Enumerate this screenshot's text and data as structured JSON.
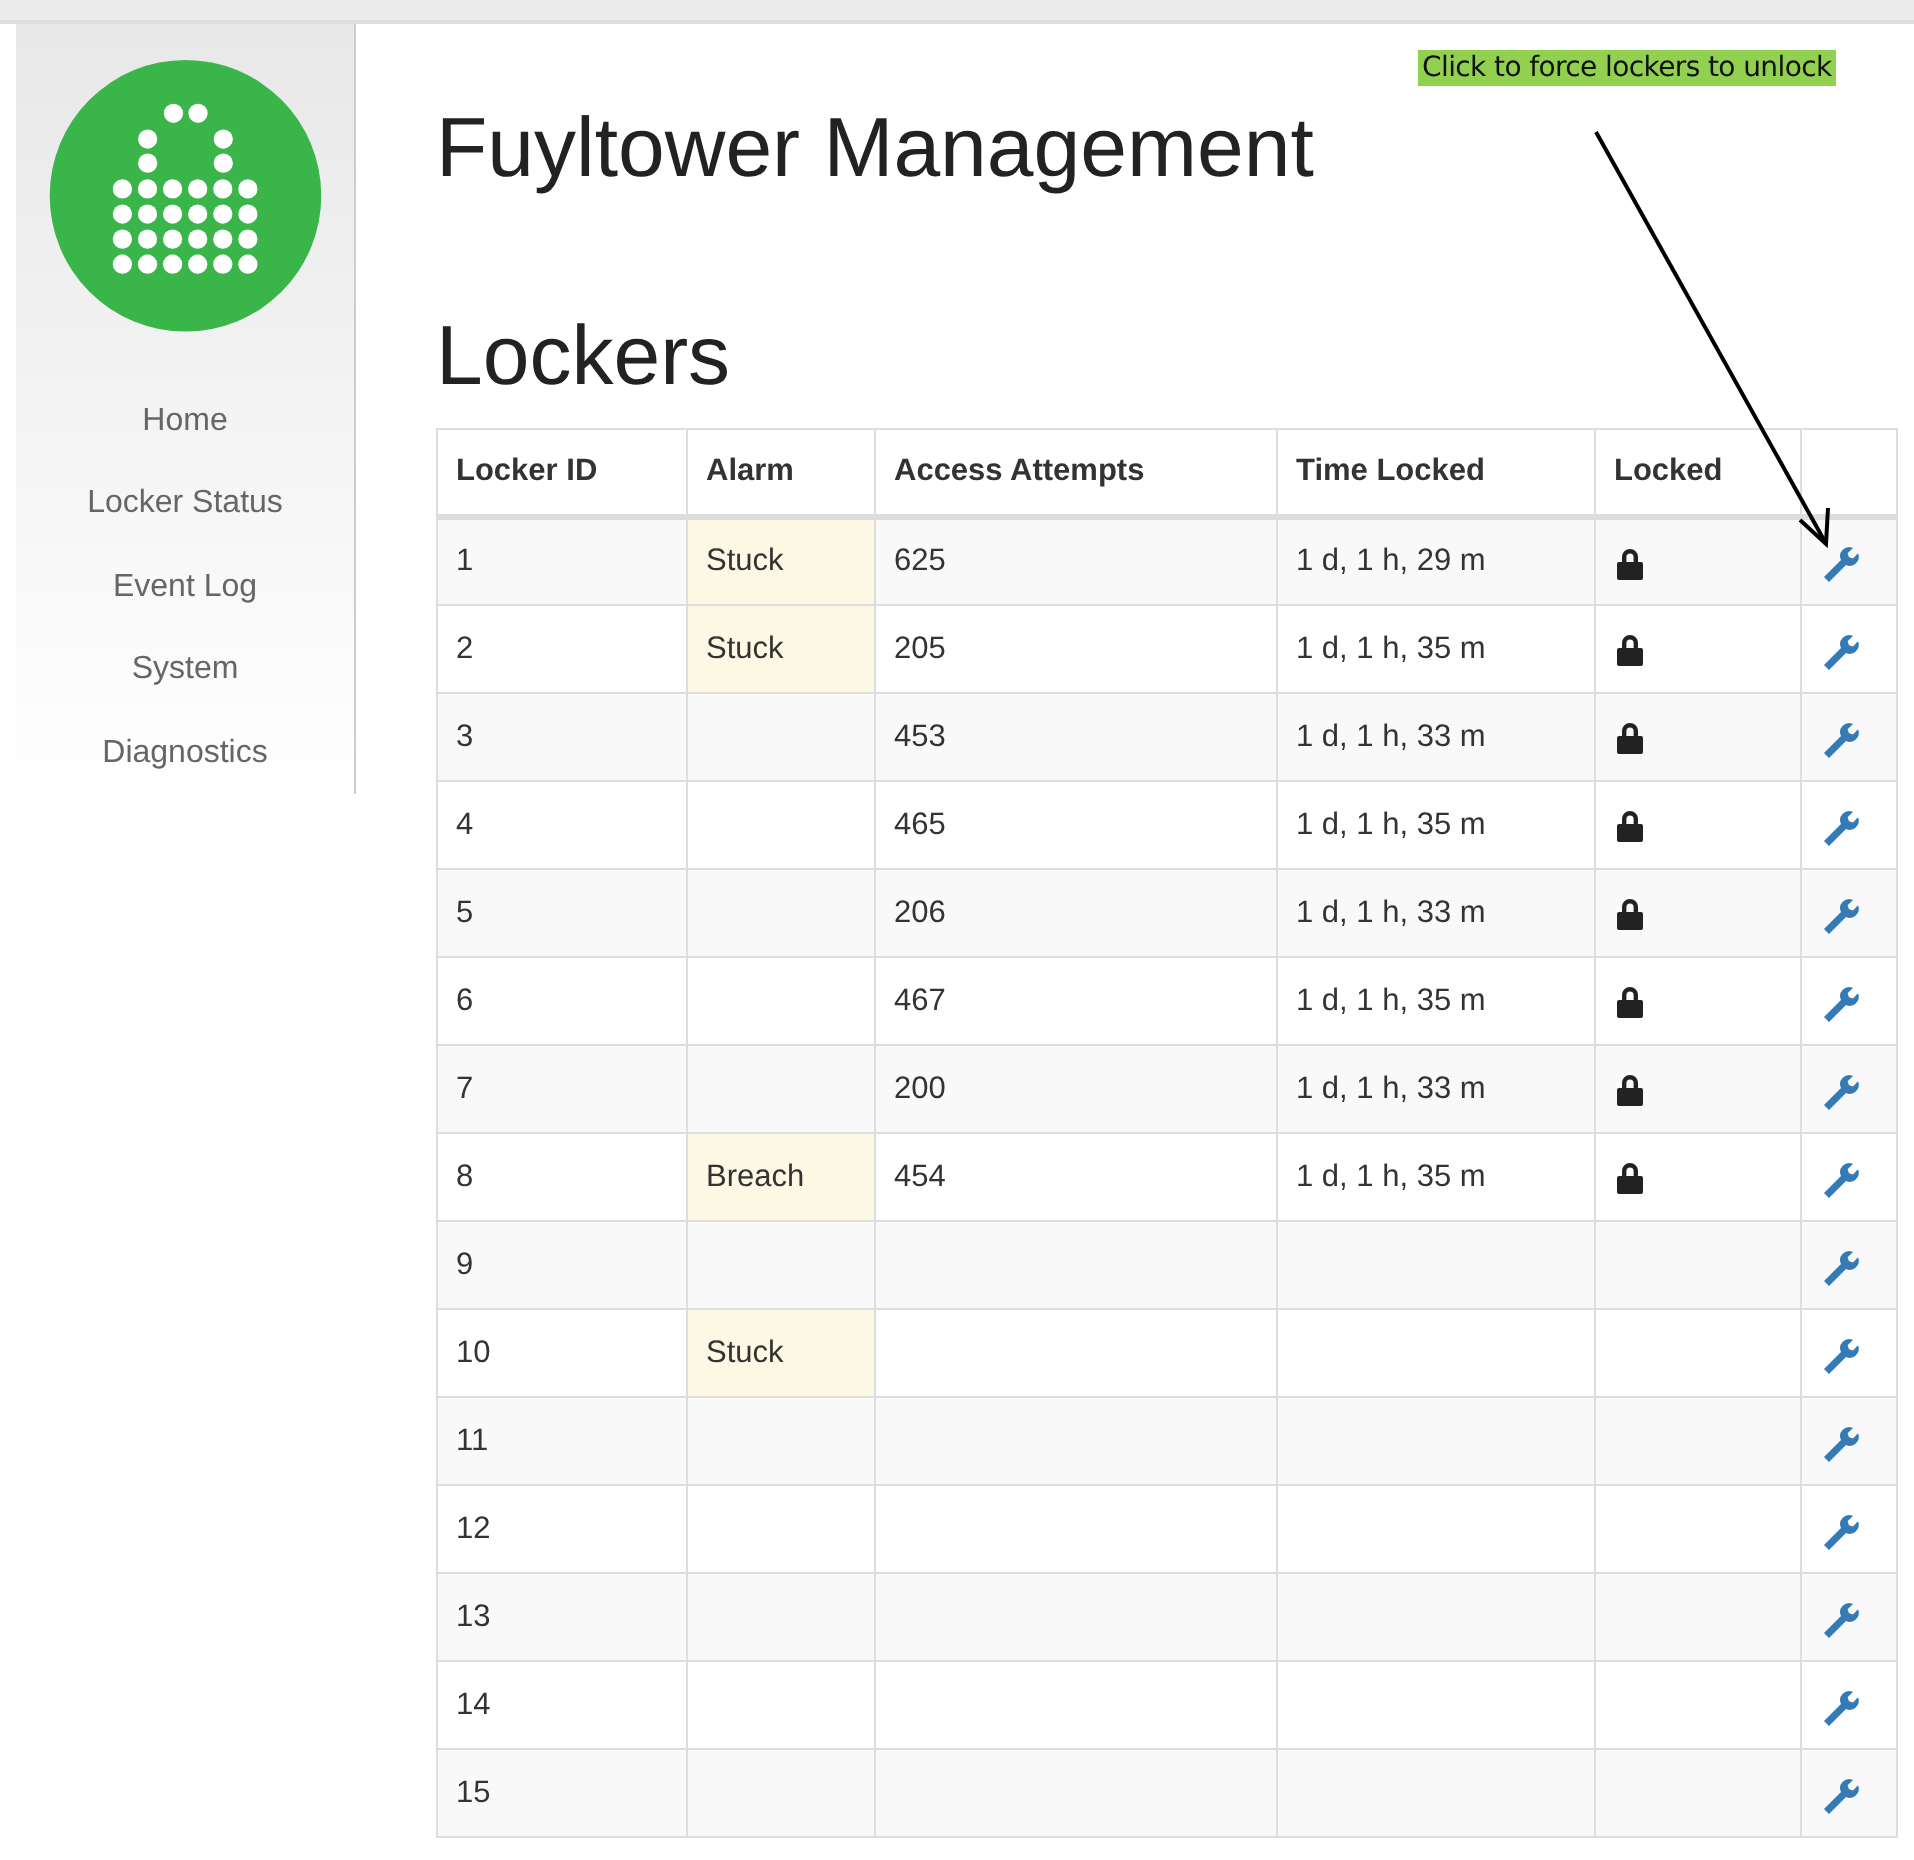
{
  "sidebar": {
    "items": [
      "Home",
      "Locker Status",
      "Event Log",
      "System",
      "Diagnostics"
    ]
  },
  "title": "Fuyltower Management",
  "annotation": "Click to force lockers to unlock",
  "section_title": "Lockers",
  "table": {
    "columns": [
      "Locker ID",
      "Alarm",
      "Access Attempts",
      "Time Locked",
      "Locked"
    ],
    "rows": [
      {
        "id": "1",
        "alarm": "Stuck",
        "attempts": "625",
        "time_locked": "1 d, 1 h, 29 m",
        "locked": true
      },
      {
        "id": "2",
        "alarm": "Stuck",
        "attempts": "205",
        "time_locked": "1 d, 1 h, 35 m",
        "locked": true
      },
      {
        "id": "3",
        "attempts": "453",
        "time_locked": "1 d, 1 h, 33 m",
        "locked": true
      },
      {
        "id": "4",
        "attempts": "465",
        "time_locked": "1 d, 1 h, 35 m",
        "locked": true
      },
      {
        "id": "5",
        "attempts": "206",
        "time_locked": "1 d, 1 h, 33 m",
        "locked": true
      },
      {
        "id": "6",
        "attempts": "467",
        "time_locked": "1 d, 1 h, 35 m",
        "locked": true
      },
      {
        "id": "7",
        "attempts": "200",
        "time_locked": "1 d, 1 h, 33 m",
        "locked": true
      },
      {
        "id": "8",
        "alarm": "Breach",
        "attempts": "454",
        "time_locked": "1 d, 1 h, 35 m",
        "locked": true
      },
      {
        "id": "9",
        "locked": false
      },
      {
        "id": "10",
        "alarm": "Stuck",
        "locked": false
      },
      {
        "id": "11",
        "locked": false
      },
      {
        "id": "12",
        "locked": false
      },
      {
        "id": "13",
        "locked": false
      },
      {
        "id": "14",
        "locked": false
      },
      {
        "id": "15",
        "locked": false
      }
    ]
  }
}
